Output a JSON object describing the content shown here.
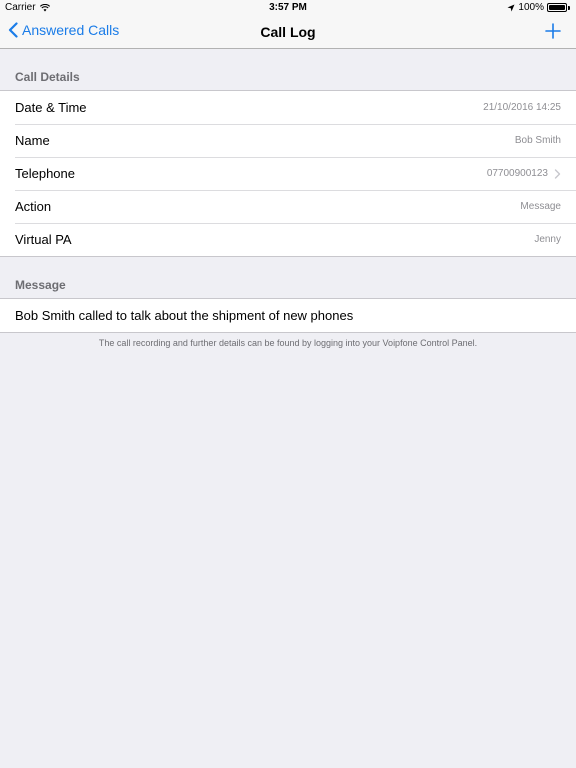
{
  "status_bar": {
    "carrier": "Carrier",
    "time": "3:57 PM",
    "battery": "100%"
  },
  "nav": {
    "back_label": "Answered Calls",
    "title": "Call Log"
  },
  "call_details": {
    "header": "Call Details",
    "rows": [
      {
        "label": "Date & Time",
        "value": "21/10/2016 14:25"
      },
      {
        "label": "Name",
        "value": "Bob Smith"
      },
      {
        "label": "Telephone",
        "value": "07700900123"
      },
      {
        "label": "Action",
        "value": "Message"
      },
      {
        "label": "Virtual PA",
        "value": "Jenny"
      }
    ]
  },
  "message": {
    "header": "Message",
    "text": "Bob Smith called to talk about the shipment of new phones",
    "footer": "The call recording and further details can be found by logging into your Voipfone Control Panel."
  },
  "colors": {
    "accent": "#1a7ce8",
    "background": "#efeff4",
    "secondary_text": "#8e8e93"
  }
}
